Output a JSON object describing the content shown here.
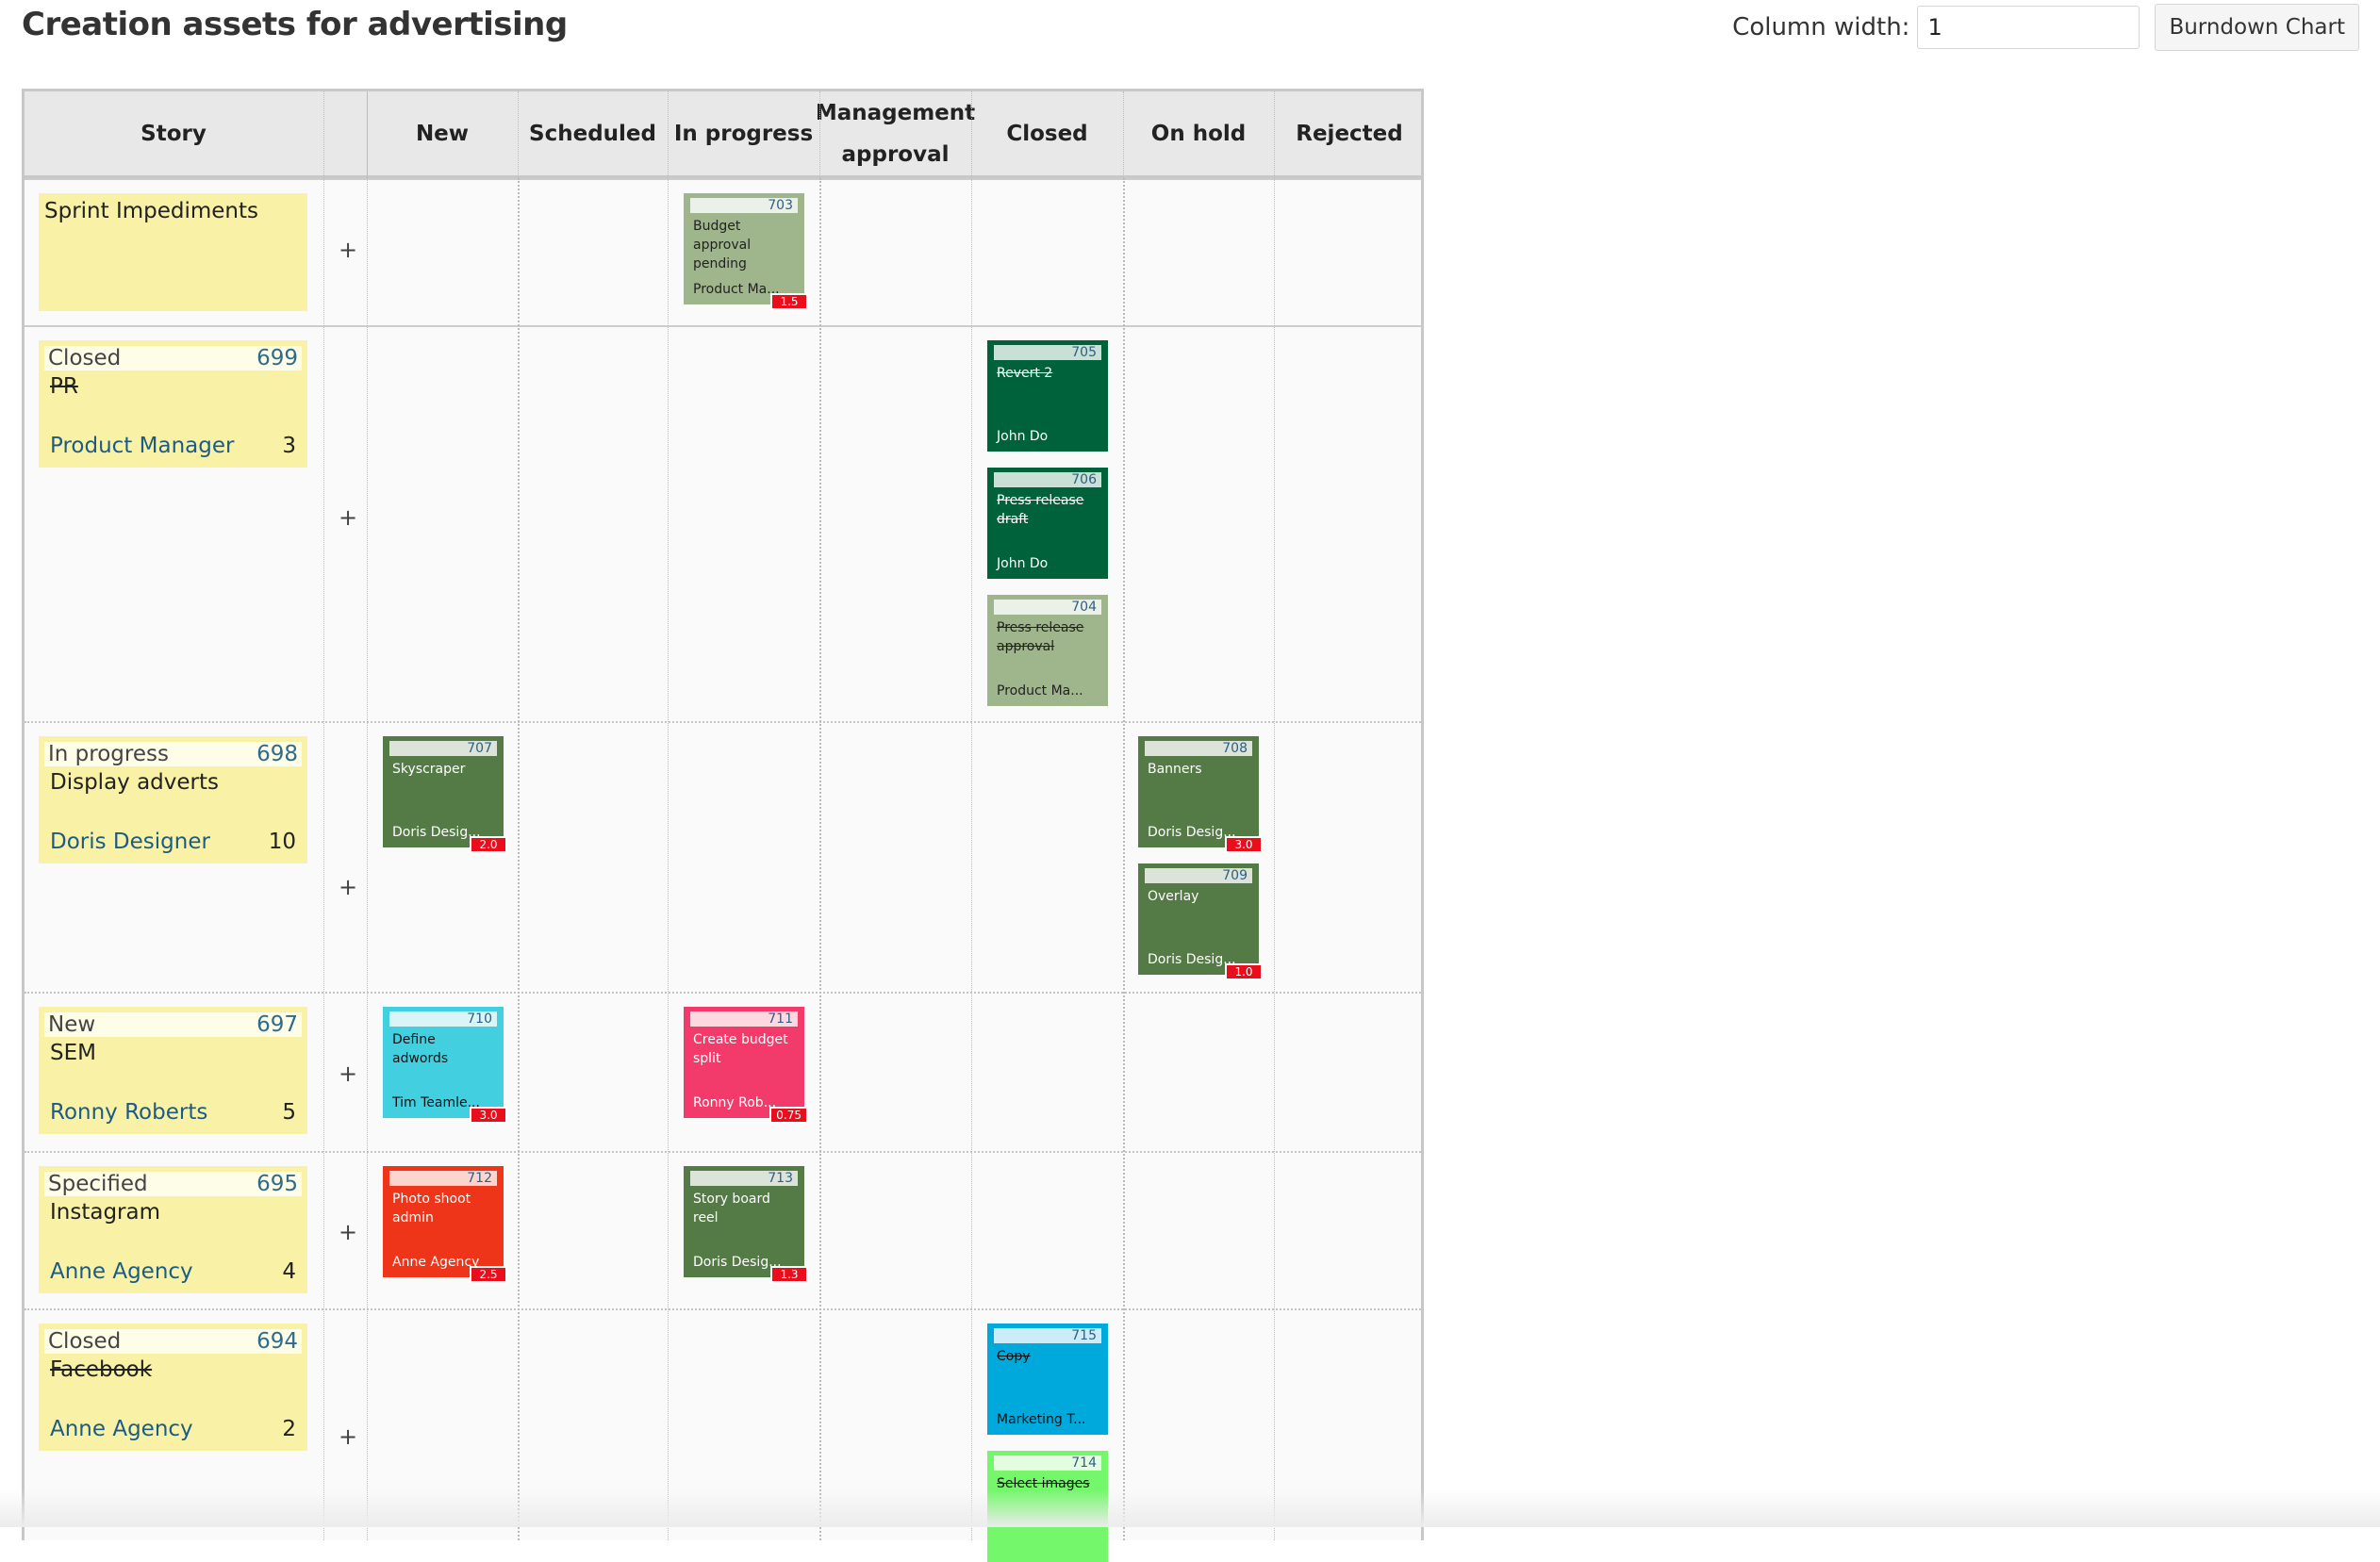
{
  "title": "Creation assets for advertising",
  "controls": {
    "column_width_label": "Column width:",
    "column_width_value": "1",
    "burndown_label": "Burndown Chart"
  },
  "columns": [
    "Story",
    "New",
    "Scheduled",
    "In progress",
    "Management approval",
    "Closed",
    "On hold",
    "Rejected"
  ],
  "column_header_lines": {
    "mgmt_line1": "Management",
    "mgmt_line2": "approval"
  },
  "plus_label": "+",
  "rows": [
    {
      "type": "impediments",
      "title": "Sprint Impediments",
      "tasks": [
        {
          "column": "In progress",
          "id": "703",
          "title": "Budget approval pending",
          "owner": "Product Ma...",
          "estimate": "1.5",
          "color": "#9fb58c",
          "bar": "#ebf0e8",
          "text": "#222222",
          "strike": false
        }
      ]
    },
    {
      "status": "Closed",
      "id": "699",
      "title": "PR",
      "owner": "Product Manager",
      "points": "3",
      "strike": true,
      "tasks": [
        {
          "column": "Closed",
          "id": "705",
          "title": "Revert 2",
          "owner": "John Do",
          "estimate": "",
          "color": "#00623a",
          "bar": "#c8e0d6",
          "text": "#ffffff",
          "strike": true
        },
        {
          "column": "Closed",
          "id": "706",
          "title": "Press release draft",
          "owner": "John Do",
          "estimate": "",
          "color": "#00623a",
          "bar": "#c8e0d6",
          "text": "#ffffff",
          "strike": true
        },
        {
          "column": "Closed",
          "id": "704",
          "title": "Press release approval",
          "owner": "Product Ma...",
          "estimate": "",
          "color": "#9fb58c",
          "bar": "#ebf0e8",
          "text": "#222222",
          "strike": true
        }
      ]
    },
    {
      "status": "In progress",
      "id": "698",
      "title": "Display adverts",
      "owner": "Doris Designer",
      "points": "10",
      "strike": false,
      "tasks": [
        {
          "column": "New",
          "id": "707",
          "title": "Skyscraper",
          "owner": "Doris Desig...",
          "estimate": "2.0",
          "color": "#547b46",
          "bar": "#dce4d9",
          "text": "#ffffff",
          "strike": false
        },
        {
          "column": "On hold",
          "id": "708",
          "title": "Banners",
          "owner": "Doris Desig...",
          "estimate": "3.0",
          "color": "#547b46",
          "bar": "#dce4d9",
          "text": "#ffffff",
          "strike": false
        },
        {
          "column": "On hold",
          "id": "709",
          "title": "Overlay",
          "owner": "Doris Desig...",
          "estimate": "1.0",
          "color": "#547b46",
          "bar": "#dce4d9",
          "text": "#ffffff",
          "strike": false
        }
      ]
    },
    {
      "status": "New",
      "id": "697",
      "title": "SEM",
      "owner": "Ronny Roberts",
      "points": "5",
      "strike": false,
      "tasks": [
        {
          "column": "New",
          "id": "710",
          "title": "Define adwords",
          "owner": "Tim Teamle...",
          "estimate": "3.0",
          "color": "#42cfdf",
          "bar": "#d9f5f8",
          "text": "#111111",
          "strike": false
        },
        {
          "column": "In progress",
          "id": "711",
          "title": "Create budget split",
          "owner": "Ronny Rob...",
          "estimate": "0.75",
          "color": "#f33b6b",
          "bar": "#fdd8e1",
          "text": "#ffffff",
          "strike": false
        }
      ]
    },
    {
      "status": "Specified",
      "id": "695",
      "title": "Instagram",
      "owner": "Anne Agency",
      "points": "4",
      "strike": false,
      "tasks": [
        {
          "column": "New",
          "id": "712",
          "title": "Photo shoot admin",
          "owner": "Anne Agency",
          "estimate": "2.5",
          "color": "#ee3419",
          "bar": "#fcd5cf",
          "text": "#ffffff",
          "strike": false
        },
        {
          "column": "In progress",
          "id": "713",
          "title": "Story board reel",
          "owner": "Doris Desig...",
          "estimate": "1.3",
          "color": "#547b46",
          "bar": "#dce4d9",
          "text": "#ffffff",
          "strike": false
        }
      ]
    },
    {
      "status": "Closed",
      "id": "694",
      "title": "Facebook",
      "owner": "Anne Agency",
      "points": "2",
      "strike": true,
      "tasks": [
        {
          "column": "Closed",
          "id": "715",
          "title": "Copy",
          "owner": "Marketing T...",
          "estimate": "",
          "color": "#00a9dc",
          "bar": "#ccecf7",
          "text": "#111111",
          "strike": true
        },
        {
          "column": "Closed",
          "id": "714",
          "title": "Select images",
          "owner": "",
          "estimate": "",
          "color": "#74f76a",
          "bar": "#e3fde1",
          "text": "#111111",
          "strike": true
        }
      ]
    }
  ]
}
